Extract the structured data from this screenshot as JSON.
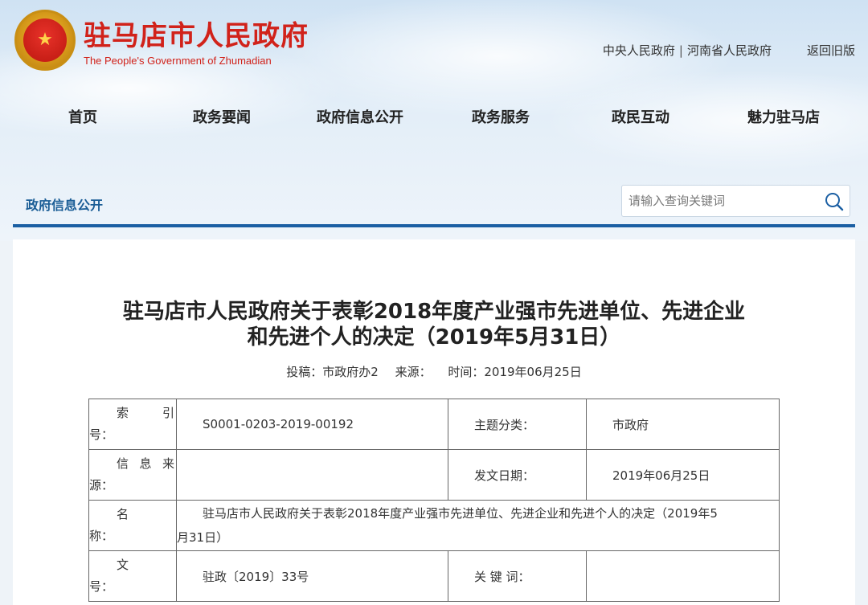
{
  "header": {
    "site_name_cn": "驻马店市人民政府",
    "site_name_en": "The People's Government of Zhumadian",
    "links": [
      "中央人民政府",
      "河南省人民政府"
    ],
    "separator": "|",
    "old_version": "返回旧版"
  },
  "nav": {
    "items": [
      "首页",
      "政务要闻",
      "政府信息公开",
      "政务服务",
      "政民互动",
      "魅力驻马店"
    ]
  },
  "section": {
    "title": "政府信息公开",
    "search_placeholder": "请输入查询关键词"
  },
  "article": {
    "title_line1": "驻马店市人民政府关于表彰2018年度产业强市先进单位、先进企业",
    "title_line2": "和先进个人的决定（2019年5月31日）",
    "meta": {
      "submitter": "投稿：市政府办2",
      "source": "来源：",
      "time": "时间：2019年06月25日"
    }
  },
  "info_table": {
    "index_label_a": "索",
    "index_label_b": "引",
    "index_label_c": "号：",
    "index_value": "S0001-0203-2019-00192",
    "category_label": "主题分类：",
    "category_value": "市政府",
    "source_label_a": "信",
    "source_label_b": "息",
    "source_label_c": "来",
    "source_label_d": "源：",
    "source_value": "",
    "date_label": "发文日期：",
    "date_value": "2019年06月25日",
    "name_label_a": "名",
    "name_label_b": "称：",
    "name_value_line1": "驻马店市人民政府关于表彰2018年度产业强市先进单位、先进企业和先进个人的决定（2019年5",
    "name_value_line2": "月31日）",
    "docno_label_a": "文",
    "docno_label_b": "号：",
    "docno_value": "驻政〔2019〕33号",
    "keywords_label": "关 键 词：",
    "keywords_value": ""
  },
  "colors": {
    "brand_red": "#d1221a",
    "brand_blue": "#1b5fa3",
    "section_blue": "#1a5d96"
  },
  "icons": {
    "emblem": "national-emblem-icon",
    "search": "search-icon"
  }
}
